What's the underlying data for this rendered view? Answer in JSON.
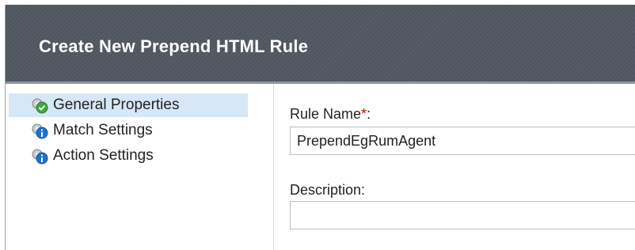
{
  "dialog": {
    "title": "Create New Prepend HTML Rule"
  },
  "sidebar": {
    "items": [
      {
        "label": "General Properties",
        "icon": "gear-check-icon",
        "selected": true
      },
      {
        "label": "Match Settings",
        "icon": "gear-info-icon",
        "selected": false
      },
      {
        "label": "Action Settings",
        "icon": "gear-info-icon",
        "selected": false
      }
    ]
  },
  "form": {
    "rule_name_label": "Rule Name",
    "required_marker": "*",
    "rule_name_colon": ":",
    "rule_name_value": "PrependEgRumAgent",
    "description_label": "Description:",
    "description_value": ""
  },
  "colors": {
    "header_bg": "#565d66",
    "selected_bg": "#d6e7f7",
    "required": "#cc0000",
    "check_green": "#3fa63f",
    "info_blue": "#1b73d1"
  }
}
